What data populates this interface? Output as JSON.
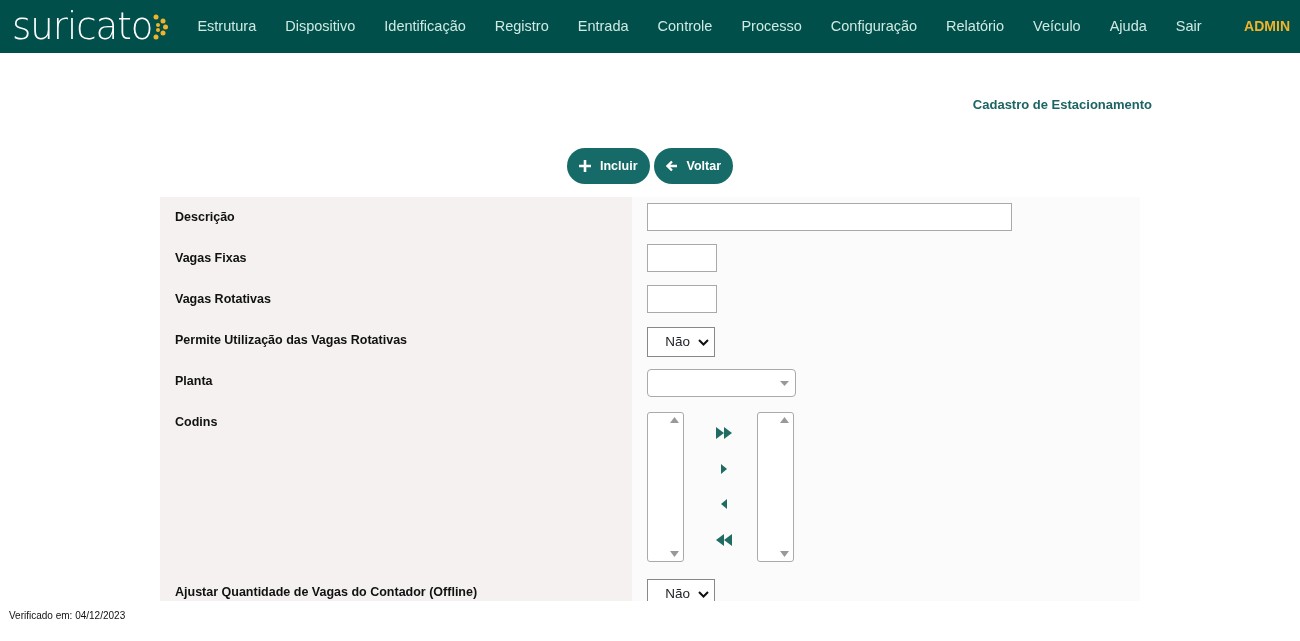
{
  "brand": {
    "logo_text": "suricato"
  },
  "nav": {
    "items": [
      "Estrutura",
      "Dispositivo",
      "Identificação",
      "Registro",
      "Entrada",
      "Controle",
      "Processo",
      "Configuração",
      "Relatório",
      "Veículo",
      "Ajuda",
      "Sair"
    ],
    "user": "ADMIN"
  },
  "page_title": "Cadastro de Estacionamento",
  "buttons": [
    {
      "label": "Incluir",
      "kind": "add"
    },
    {
      "label": "Voltar",
      "kind": "back"
    }
  ],
  "fields": [
    {
      "label": "Descrição",
      "kind": "text-wide"
    },
    {
      "label": "Vagas Fixas",
      "kind": "text-short"
    },
    {
      "label": "Vagas Rotativas",
      "kind": "text-short"
    },
    {
      "label": "Permite Utilização das Vagas Rotativas",
      "kind": "select",
      "value": "Não"
    },
    {
      "label": "Planta",
      "kind": "combo"
    },
    {
      "label": "Codins",
      "kind": "dual-list"
    },
    {
      "label": "Ajustar Quantidade de Vagas do Contador (Offline)",
      "kind": "select",
      "value": "Não"
    }
  ],
  "footer": "Verificado em: 04/12/2023"
}
